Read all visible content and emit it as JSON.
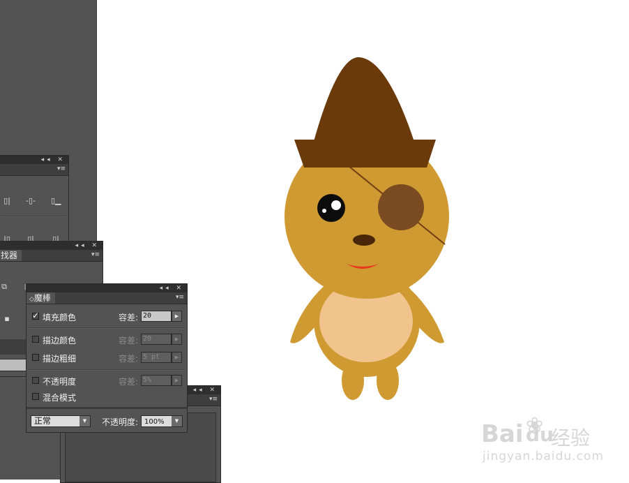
{
  "pathfinder_panel": {
    "tab_label": "找器"
  },
  "magic_wand_panel": {
    "tab_label": "魔棒",
    "tab_icon": "◇",
    "tolerance_label": "容差:",
    "options": [
      {
        "label": "填充颜色",
        "checked": true,
        "value": "20",
        "enabled": true
      },
      {
        "label": "描边颜色",
        "checked": false,
        "value": "20",
        "enabled": false
      },
      {
        "label": "描边粗细",
        "checked": false,
        "value": "5 pt",
        "enabled": false
      },
      {
        "label": "不透明度",
        "checked": false,
        "value": "5%",
        "enabled": false
      },
      {
        "label": "混合模式",
        "checked": false
      }
    ],
    "blend_mode": "正常",
    "opacity_label": "不透明度:",
    "opacity_value": "100%"
  },
  "colors": {
    "ui_panel": "#535353",
    "hat": "#6b3a0b",
    "body": "#cf9a31",
    "belly": "#f0c48c",
    "eyepatch": "#7a4a20",
    "mouth": "#e8341d"
  },
  "watermark": {
    "logo_text": "Bai",
    "logo_text2": "du",
    "cn_text": "经验",
    "url": "jingyan.baidu.com"
  }
}
